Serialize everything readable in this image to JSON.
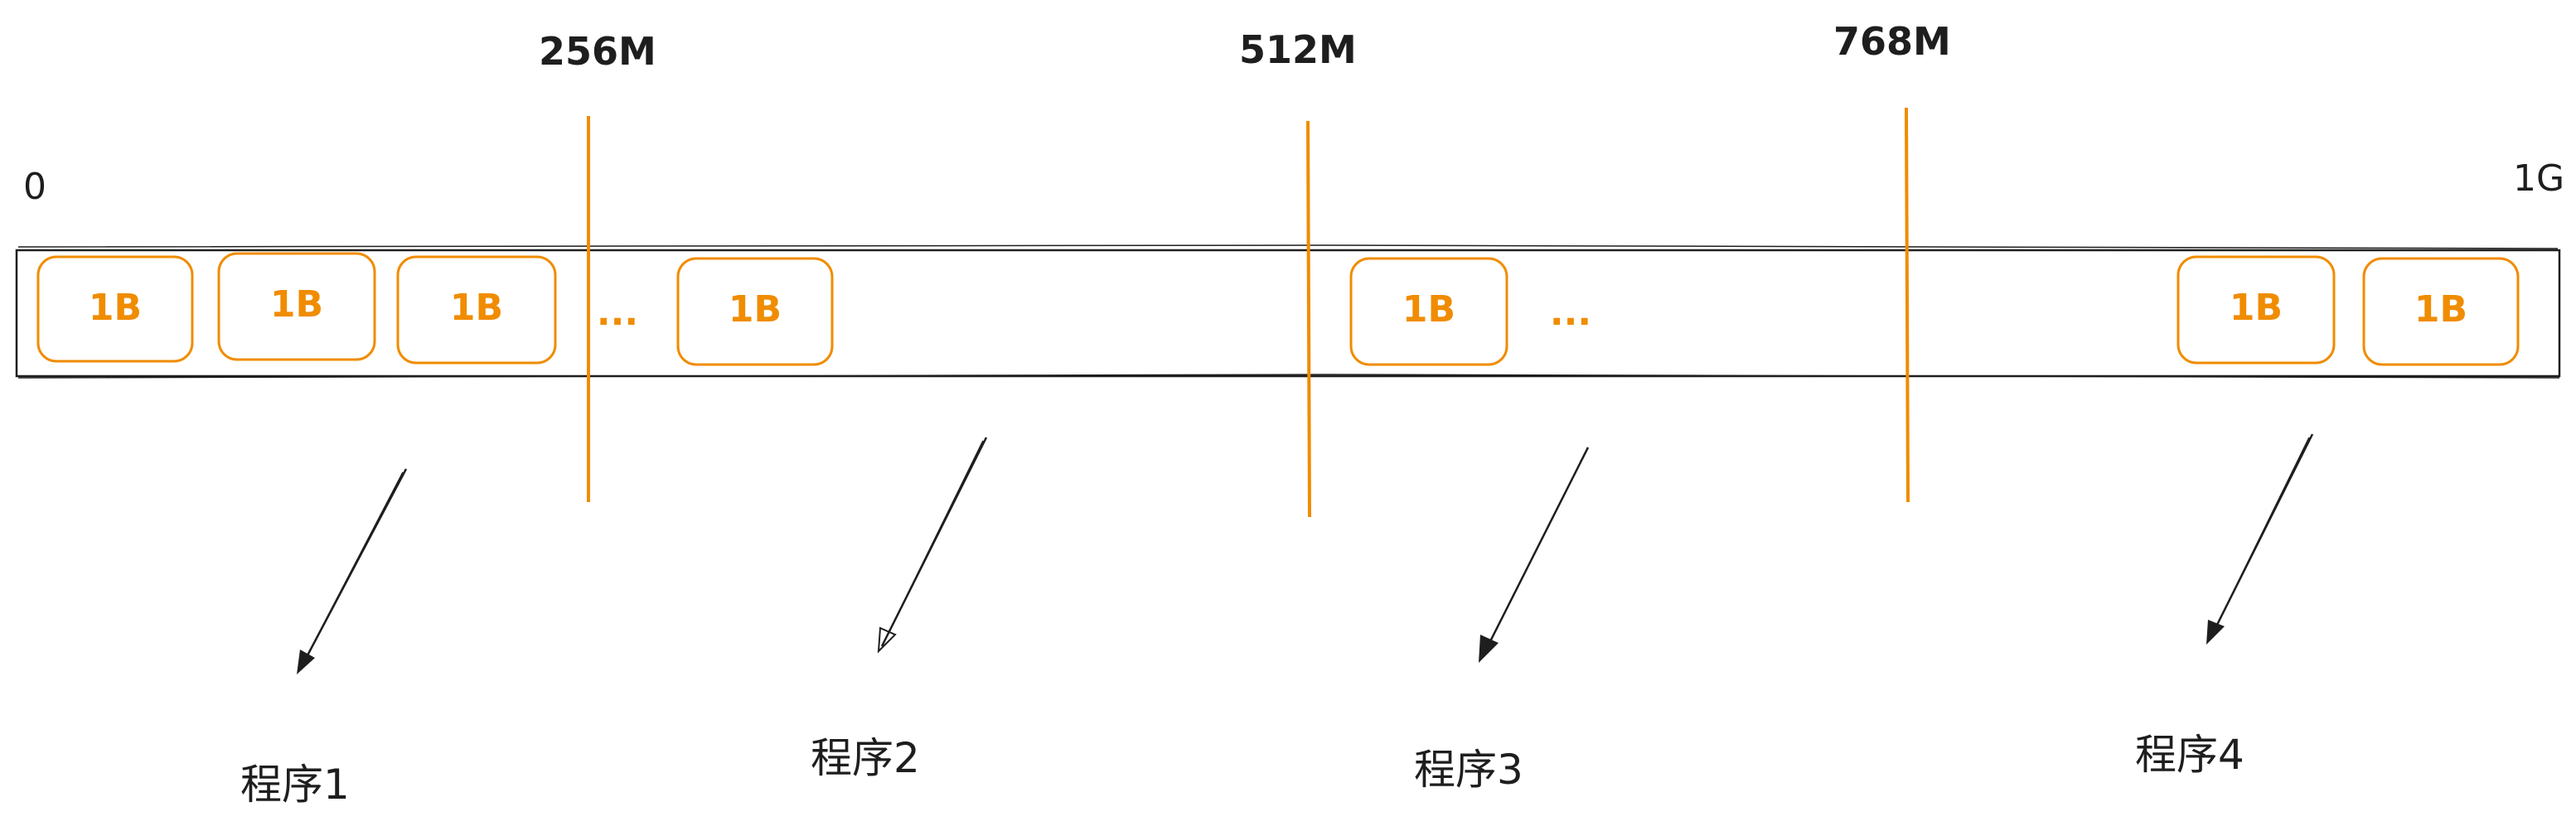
{
  "colors": {
    "accent": "#f08c00",
    "ink": "#1e1e1e",
    "background": "#ffffff"
  },
  "scale": {
    "start_label": "0",
    "end_label": "1G",
    "markers": [
      {
        "label": "256M"
      },
      {
        "label": "512M"
      },
      {
        "label": "768M"
      }
    ]
  },
  "blocks": [
    {
      "label": "1B"
    },
    {
      "label": "1B"
    },
    {
      "label": "1B"
    },
    {
      "label": "1B"
    },
    {
      "label": "1B"
    },
    {
      "label": "1B"
    },
    {
      "label": "1B"
    }
  ],
  "ellipses": [
    {
      "label": "..."
    },
    {
      "label": "..."
    }
  ],
  "programs": [
    {
      "label": "程序1"
    },
    {
      "label": "程序2"
    },
    {
      "label": "程序3"
    },
    {
      "label": "程序4"
    }
  ],
  "arrow_icon": "arrow-down-left-icon"
}
